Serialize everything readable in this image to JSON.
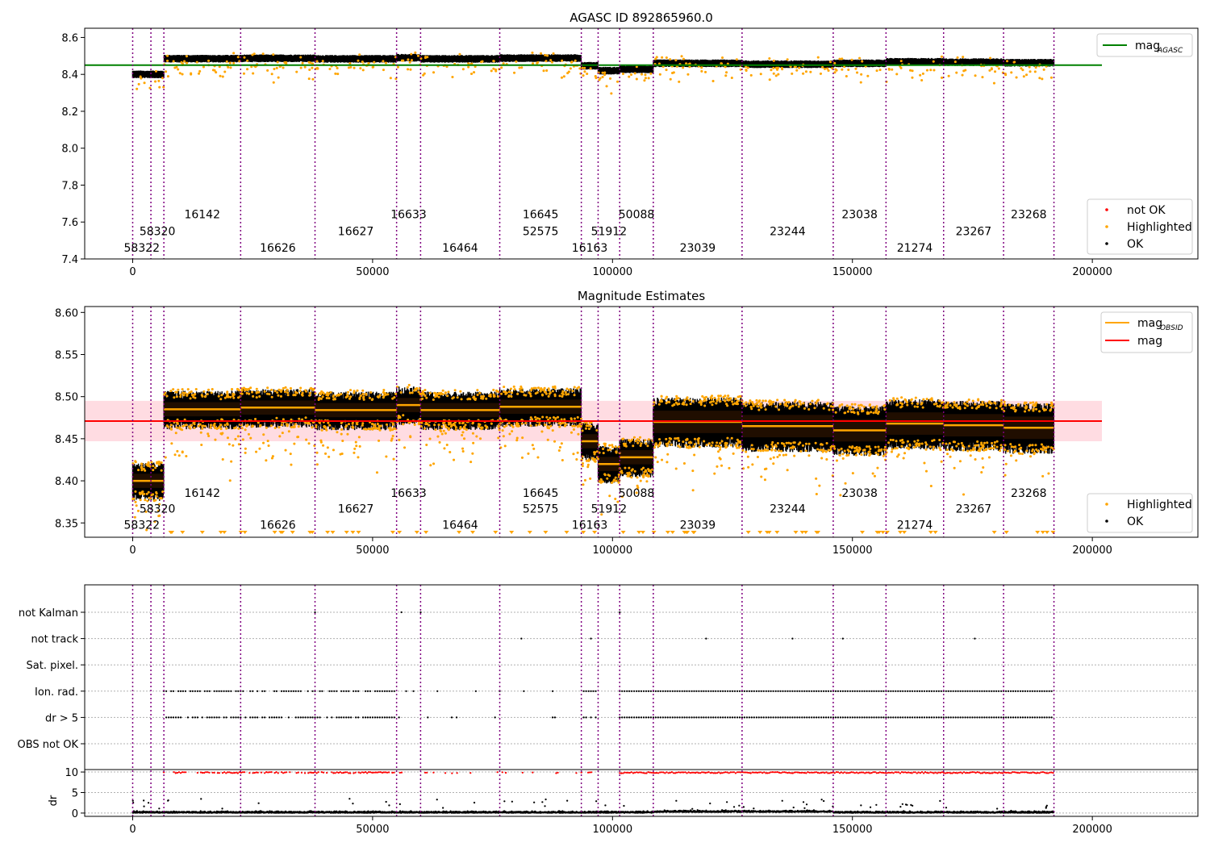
{
  "chart_data": [
    {
      "type": "scatter",
      "title": "AGASC ID 892865960.0",
      "xlim": [
        -10000,
        222000
      ],
      "ylim": [
        7.4,
        8.65
      ],
      "xticks": [
        0,
        50000,
        100000,
        150000,
        200000
      ],
      "yticks": [
        7.4,
        7.6,
        7.8,
        8.0,
        8.2,
        8.4,
        8.6
      ],
      "ytick_labels": [
        "7.4",
        "7.6",
        "7.8",
        "8.0",
        "8.2",
        "8.4",
        "8.6"
      ],
      "hline": {
        "name": "mag",
        "subscript": "AGASC",
        "value": 8.45,
        "x": [
          -10000,
          202000
        ],
        "color": "#008000"
      },
      "legend_lines": [
        {
          "name": "mag",
          "subscript": "AGASC",
          "color": "#008000"
        }
      ],
      "legend_points": [
        {
          "name": "not OK",
          "color": "#ff0000"
        },
        {
          "name": "Highlighted",
          "color": "#ffa500"
        },
        {
          "name": "OK",
          "color": "#000000"
        }
      ],
      "obs_label_rows_y": [
        7.62,
        7.53,
        7.44
      ],
      "segments": [
        {
          "start": 0,
          "end": 3800,
          "mag": 8.4
        },
        {
          "start": 3800,
          "end": 6500,
          "mag": 8.4
        },
        {
          "start": 6500,
          "end": 22500,
          "mag": 8.485
        },
        {
          "start": 22500,
          "end": 38000,
          "mag": 8.487
        },
        {
          "start": 38000,
          "end": 55000,
          "mag": 8.484
        },
        {
          "start": 55000,
          "end": 60000,
          "mag": 8.49
        },
        {
          "start": 60000,
          "end": 76500,
          "mag": 8.484
        },
        {
          "start": 76500,
          "end": 93500,
          "mag": 8.488
        },
        {
          "start": 93500,
          "end": 97000,
          "mag": 8.447
        },
        {
          "start": 97000,
          "end": 101500,
          "mag": 8.42
        },
        {
          "start": 101500,
          "end": 108500,
          "mag": 8.428
        },
        {
          "start": 108500,
          "end": 127000,
          "mag": 8.47
        },
        {
          "start": 127000,
          "end": 146000,
          "mag": 8.465
        },
        {
          "start": 146000,
          "end": 157000,
          "mag": 8.46
        },
        {
          "start": 157000,
          "end": 169000,
          "mag": 8.468
        },
        {
          "start": 169000,
          "end": 181500,
          "mag": 8.466
        },
        {
          "start": 181500,
          "end": 192000,
          "mag": 8.463
        }
      ]
    },
    {
      "type": "scatter",
      "title": "Magnitude Estimates",
      "xlim": [
        -10000,
        222000
      ],
      "ylim": [
        8.333,
        8.607
      ],
      "xticks": [
        0,
        50000,
        100000,
        150000,
        200000
      ],
      "yticks": [
        8.35,
        8.4,
        8.45,
        8.5,
        8.55,
        8.6
      ],
      "ytick_labels": [
        "8.35",
        "8.40",
        "8.45",
        "8.50",
        "8.55",
        "8.60"
      ],
      "mean_line": {
        "name": "mag",
        "value": 8.471,
        "band": [
          8.447,
          8.495
        ],
        "x": [
          -10000,
          202000
        ],
        "color": "#ff0000"
      },
      "obsid_line": {
        "name": "mag",
        "subscript": "OBSID",
        "color": "#ffa500"
      },
      "legend_lines": [
        {
          "name": "mag",
          "subscript": "OBSID",
          "color": "#ffa500"
        },
        {
          "name": "mag",
          "subscript": "",
          "color": "#ff0000"
        }
      ],
      "legend_points": [
        {
          "name": "Highlighted",
          "color": "#ffa500"
        },
        {
          "name": "OK",
          "color": "#000000"
        }
      ],
      "obs_label_rows_y": [
        8.381,
        8.362,
        8.343
      ]
    },
    {
      "type": "scatter",
      "title": "",
      "xlim": [
        -10000,
        222000
      ],
      "xticks": [
        0,
        50000,
        100000,
        150000,
        200000
      ],
      "flag_rows": [
        "not Kalman",
        "not track",
        "Sat. pixel.",
        "Ion. rad.",
        "dr > 5",
        "OBS not OK"
      ],
      "dr_axis": {
        "label": "dr",
        "ylim": [
          -0.8,
          10.6
        ],
        "yticks": [
          0,
          5,
          10
        ],
        "ytick_labels": [
          "0",
          "5",
          "10"
        ]
      }
    }
  ],
  "observations": [
    {
      "obsid": "58322",
      "start": 0,
      "row": 2
    },
    {
      "obsid": "58320",
      "start": 3800,
      "row": 1
    },
    {
      "obsid": "16142",
      "start": 6500,
      "row": 0
    },
    {
      "obsid": "16626",
      "start": 22500,
      "row": 2
    },
    {
      "obsid": "16627",
      "start": 38000,
      "row": 1
    },
    {
      "obsid": "16633",
      "start": 55000,
      "row": 0
    },
    {
      "obsid": "16464",
      "start": 60000,
      "row": 2
    },
    {
      "obsid": "52575",
      "start": 76500,
      "row": 1
    },
    {
      "obsid": "16645",
      "start": 76500,
      "row": 0
    },
    {
      "obsid": "16163",
      "start": 93500,
      "row": 2
    },
    {
      "obsid": "51912",
      "start": 97000,
      "row": 1
    },
    {
      "obsid": "50088",
      "start": 101500,
      "row": 0
    },
    {
      "obsid": "23039",
      "start": 108500,
      "row": 2
    },
    {
      "obsid": "23244",
      "start": 127000,
      "row": 1
    },
    {
      "obsid": "23038",
      "start": 146000,
      "row": 0
    },
    {
      "obsid": "21274",
      "start": 157000,
      "row": 2
    },
    {
      "obsid": "23267",
      "start": 169000,
      "row": 1
    },
    {
      "obsid": "23268",
      "start": 181500,
      "row": 0
    }
  ],
  "boundaries": [
    0,
    3800,
    6500,
    22500,
    38000,
    55000,
    60000,
    76500,
    93500,
    97000,
    101500,
    108500,
    127000,
    146000,
    157000,
    169000,
    181500,
    192000
  ],
  "tick_labels": [
    "0",
    "50000",
    "100000",
    "150000",
    "200000"
  ],
  "colors": {
    "ok": "#000000",
    "highlighted": "#ffa500",
    "not_ok": "#ff0000",
    "boundary": "#800080",
    "agasc": "#008000",
    "mean": "#ff0000",
    "band": "#ffc0cb"
  }
}
